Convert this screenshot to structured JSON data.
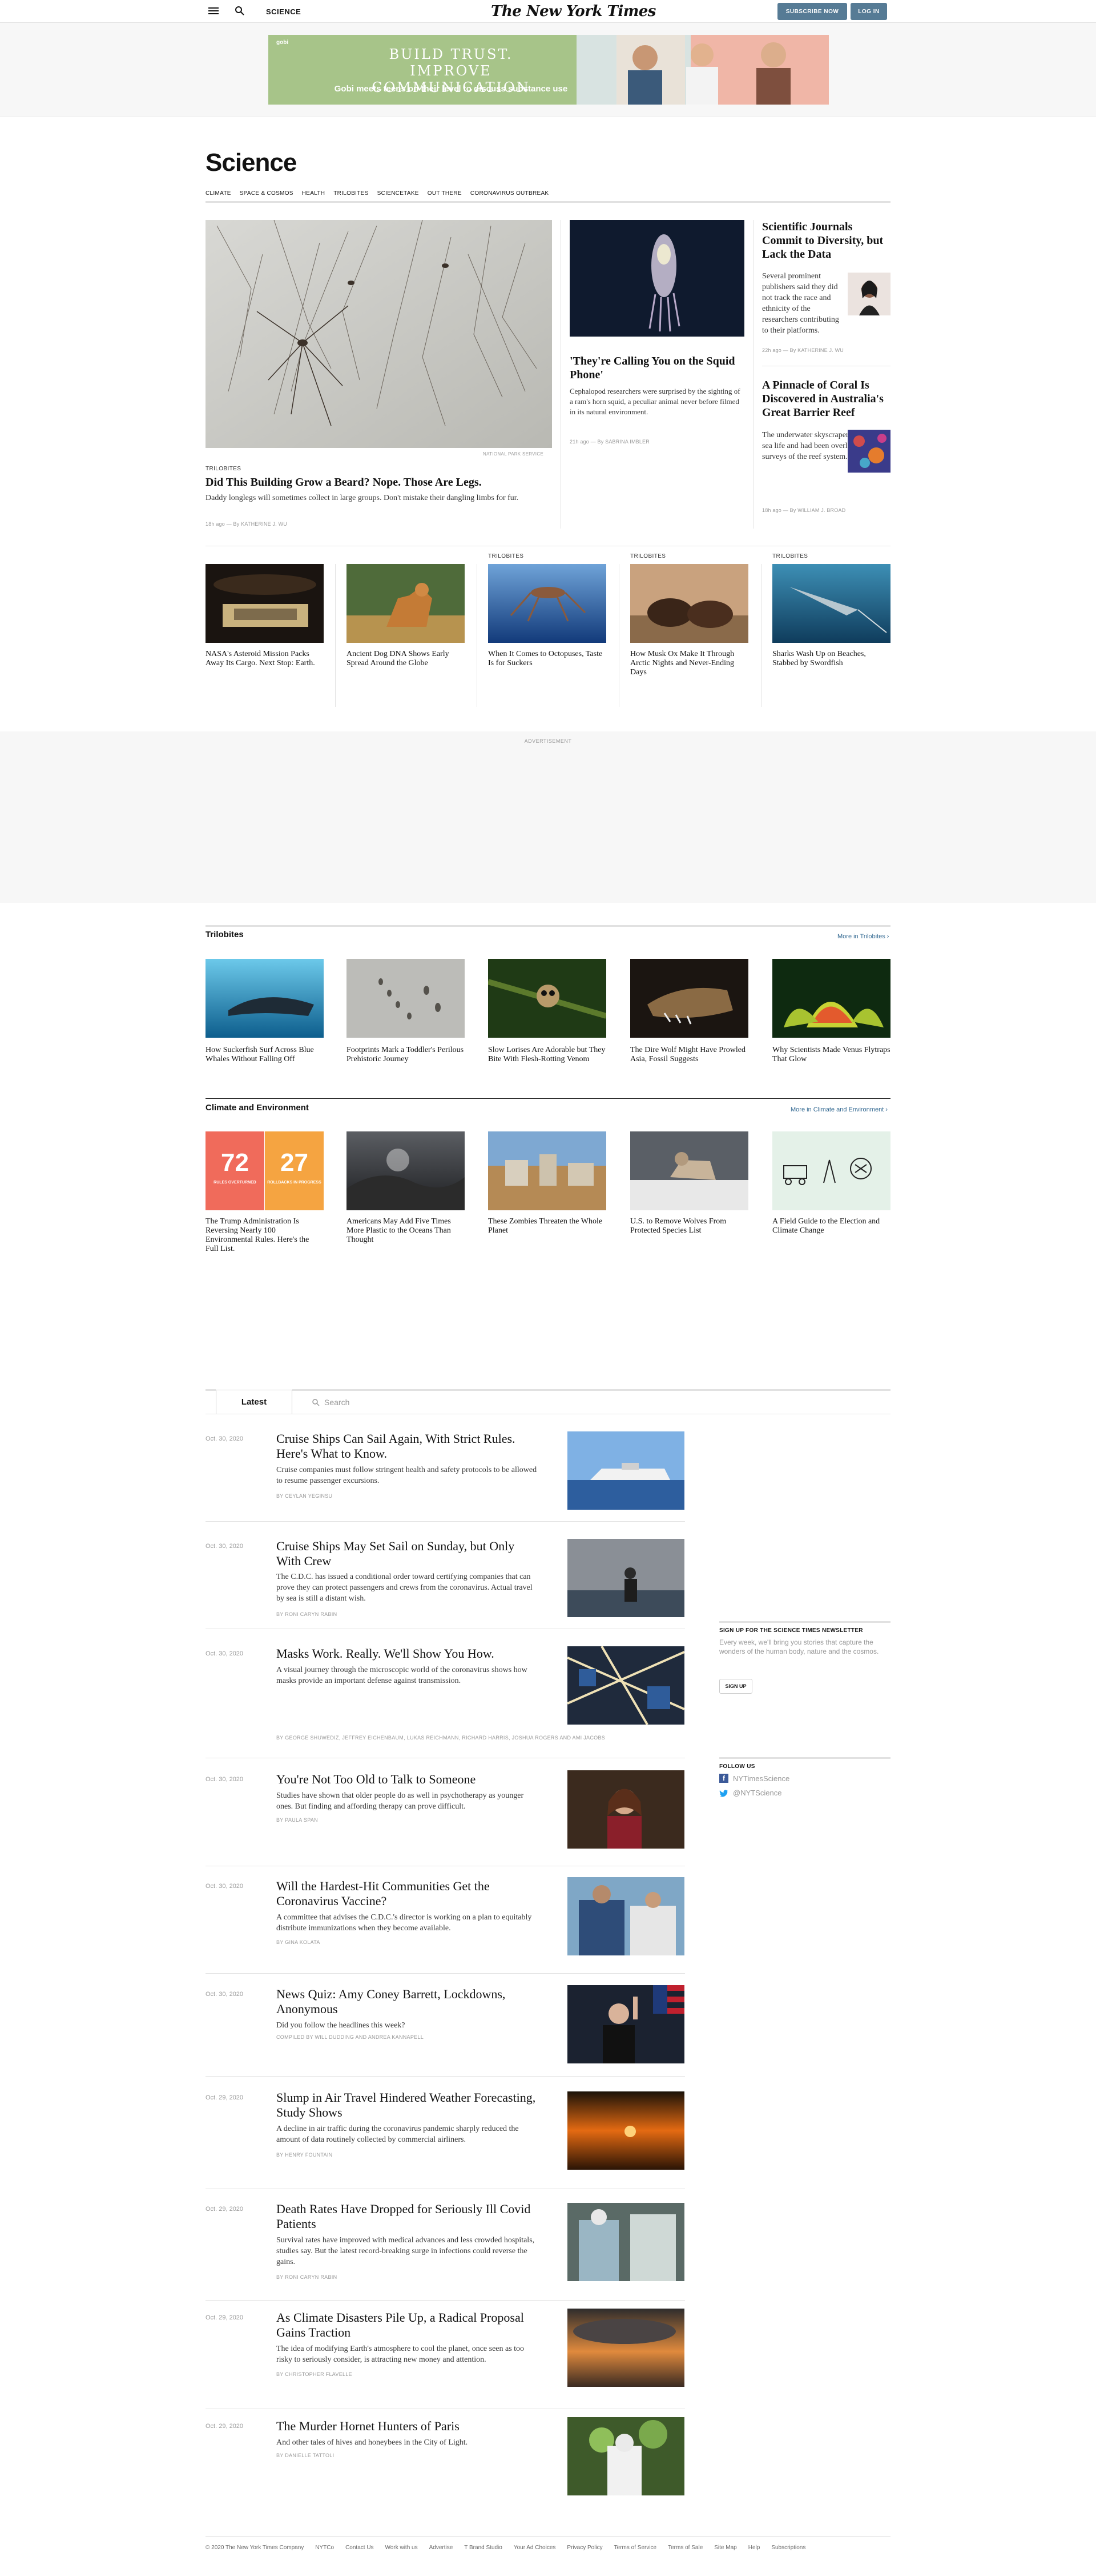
{
  "nav": {
    "section": "SCIENCE",
    "logo": "The New York Times",
    "subscribe": "SUBSCRIBE NOW",
    "login": "LOG IN"
  },
  "ad": {
    "logo": "gobi",
    "line1": "BUILD TRUST.",
    "line2": "IMPROVE COMMUNICATION",
    "line3": "Gobi meets teens on their level to discuss substance use"
  },
  "page_title": "Science",
  "subnav": [
    "CLIMATE",
    "SPACE & COSMOS",
    "HEALTH",
    "TRILOBITES",
    "SCIENCETAKE",
    "OUT THERE",
    "CORONAVIRUS OUTBREAK"
  ],
  "lead": {
    "credit": "NATIONAL PARK SERVICE",
    "kicker": "TRILOBITES",
    "headline": "Did This Building Grow a Beard? Nope. Those Are Legs.",
    "summary": "Daddy longlegs will sometimes collect in large groups. Don't mistake their dangling limbs for fur.",
    "meta": "18h ago — By KATHERINE J. WU"
  },
  "squid": {
    "headline": "'They're Calling You on the Squid Phone'",
    "summary": "Cephalopod researchers were surprised by the sighting of a ram's horn squid, a peculiar animal never before filmed in its natural environment.",
    "meta": "21h ago — By SABRINA IMBLER"
  },
  "journals": {
    "headline": "Scientific Journals Commit to Diversity, but Lack the Data",
    "summary": "Several prominent publishers said they did not track the race and ethnicity of the researchers contributing to their platforms.",
    "meta": "22h ago — By KATHERINE J. WU"
  },
  "coral": {
    "headline": "A Pinnacle of Coral Is Discovered in Australia's Great Barrier Reef",
    "summary": "The underwater skyscraper teems with sea life and had been overlooked in past surveys of the reef system.",
    "meta": "18h ago — By WILLIAM J. BROAD"
  },
  "row_cards": [
    {
      "kicker": "",
      "headline": "NASA's Asteroid Mission Packs Away Its Cargo. Next Stop: Earth."
    },
    {
      "kicker": "",
      "headline": "Ancient Dog DNA Shows Early Spread Around the Globe"
    },
    {
      "kicker": "TRILOBITES",
      "headline": "When It Comes to Octopuses, Taste Is for Suckers"
    },
    {
      "kicker": "TRILOBITES",
      "headline": "How Musk Ox Make It Through Arctic Nights and Never-Ending Days"
    },
    {
      "kicker": "TRILOBITES",
      "headline": "Sharks Wash Up on Beaches, Stabbed by Swordfish"
    }
  ],
  "advertisement_label": "ADVERTISEMENT",
  "trilobites": {
    "title": "Trilobites",
    "more": "More in Trilobites ›",
    "cards": [
      "How Suckerfish Surf Across Blue Whales Without Falling Off",
      "Footprints Mark a Toddler's Perilous Prehistoric Journey",
      "Slow Lorises Are Adorable but They Bite With Flesh-Rotting Venom",
      "The Dire Wolf Might Have Prowled Asia, Fossil Suggests",
      "Why Scientists Made Venus Flytraps That Glow"
    ]
  },
  "climate": {
    "title": "Climate and Environment",
    "more": "More in Climate and Environment ›",
    "stat1": "72",
    "stat1_label": "RULES OVERTURNED",
    "stat2": "27",
    "stat2_label": "ROLLBACKS IN PROGRESS",
    "cards": [
      "The Trump Administration Is Reversing Nearly 100 Environmental Rules. Here's the Full List.",
      "Americans May Add Five Times More Plastic to the Oceans Than Thought",
      "These Zombies Threaten the Whole Planet",
      "U.S. to Remove Wolves From Protected Species List",
      "A Field Guide to the Election and Climate Change"
    ]
  },
  "latest": {
    "tab": "Latest",
    "search_placeholder": "Search",
    "items": [
      {
        "date": "Oct. 30, 2020",
        "headline": "Cruise Ships Can Sail Again, With Strict Rules. Here's What to Know.",
        "summary": "Cruise companies must follow stringent health and safety protocols to be allowed to resume passenger excursions.",
        "byline": "By CEYLAN YEGINSU"
      },
      {
        "date": "Oct. 30, 2020",
        "headline": "Cruise Ships May Set Sail on Sunday, but Only With Crew",
        "summary": "The C.D.C. has issued a conditional order toward certifying companies that can prove they can protect passengers and crews from the coronavirus. Actual travel by sea is still a distant wish.",
        "byline": "By RONI CARYN RABIN"
      },
      {
        "date": "Oct. 30, 2020",
        "headline": "Masks Work. Really. We'll Show You How.",
        "summary": "A visual journey through the microscopic world of the coronavirus shows how masks provide an important defense against transmission.",
        "byline": "By GEORGE SHUWEDIZ, JEFFREY EICHENBAUM, LUKAS REICHMANN, RICHARD HARRIS, JOSHUA ROGERS and AMI JACOBS"
      },
      {
        "date": "Oct. 30, 2020",
        "headline": "You're Not Too Old to Talk to Someone",
        "summary": "Studies have shown that older people do as well in psychotherapy as younger ones. But finding and affording therapy can prove difficult.",
        "byline": "By PAULA SPAN"
      },
      {
        "date": "Oct. 30, 2020",
        "headline": "Will the Hardest-Hit Communities Get the Coronavirus Vaccine?",
        "summary": "A committee that advises the C.D.C.'s director is working on a plan to equitably distribute immunizations when they become available.",
        "byline": "By GINA KOLATA"
      },
      {
        "date": "Oct. 30, 2020",
        "headline": "News Quiz: Amy Coney Barrett, Lockdowns, Anonymous",
        "summary": "Did you follow the headlines this week?",
        "byline": "Compiled by WILL DUDDING and ANDREA KANNAPELL"
      },
      {
        "date": "Oct. 29, 2020",
        "headline": "Slump in Air Travel Hindered Weather Forecasting, Study Shows",
        "summary": "A decline in air traffic during the coronavirus pandemic sharply reduced the amount of data routinely collected by commercial airliners.",
        "byline": "By HENRY FOUNTAIN"
      },
      {
        "date": "Oct. 29, 2020",
        "headline": "Death Rates Have Dropped for Seriously Ill Covid Patients",
        "summary": "Survival rates have improved with medical advances and less crowded hospitals, studies say. But the latest record-breaking surge in infections could reverse the gains.",
        "byline": "By RONI CARYN RABIN"
      },
      {
        "date": "Oct. 29, 2020",
        "headline": "As Climate Disasters Pile Up, a Radical Proposal Gains Traction",
        "summary": "The idea of modifying Earth's atmosphere to cool the planet, once seen as too risky to seriously consider, is attracting new money and attention.",
        "byline": "By CHRISTOPHER FLAVELLE"
      },
      {
        "date": "Oct. 29, 2020",
        "headline": "The Murder Hornet Hunters of Paris",
        "summary": "And other tales of hives and honeybees in the City of Light.",
        "byline": "By DANIELLE TATTOLI"
      }
    ]
  },
  "newsletter": {
    "title": "SIGN UP FOR THE SCIENCE TIMES NEWSLETTER",
    "text": "Every week, we'll bring you stories that capture the wonders of the human body, nature and the cosmos.",
    "button": "SIGN UP"
  },
  "follow": {
    "title": "FOLLOW US",
    "facebook": "NYTimesScience",
    "twitter": "@NYTScience"
  },
  "footer": [
    "© 2020 The New York Times Company",
    "NYTCo",
    "Contact Us",
    "Work with us",
    "Advertise",
    "T Brand Studio",
    "Your Ad Choices",
    "Privacy Policy",
    "Terms of Service",
    "Terms of Sale",
    "Site Map",
    "Help",
    "Subscriptions"
  ]
}
